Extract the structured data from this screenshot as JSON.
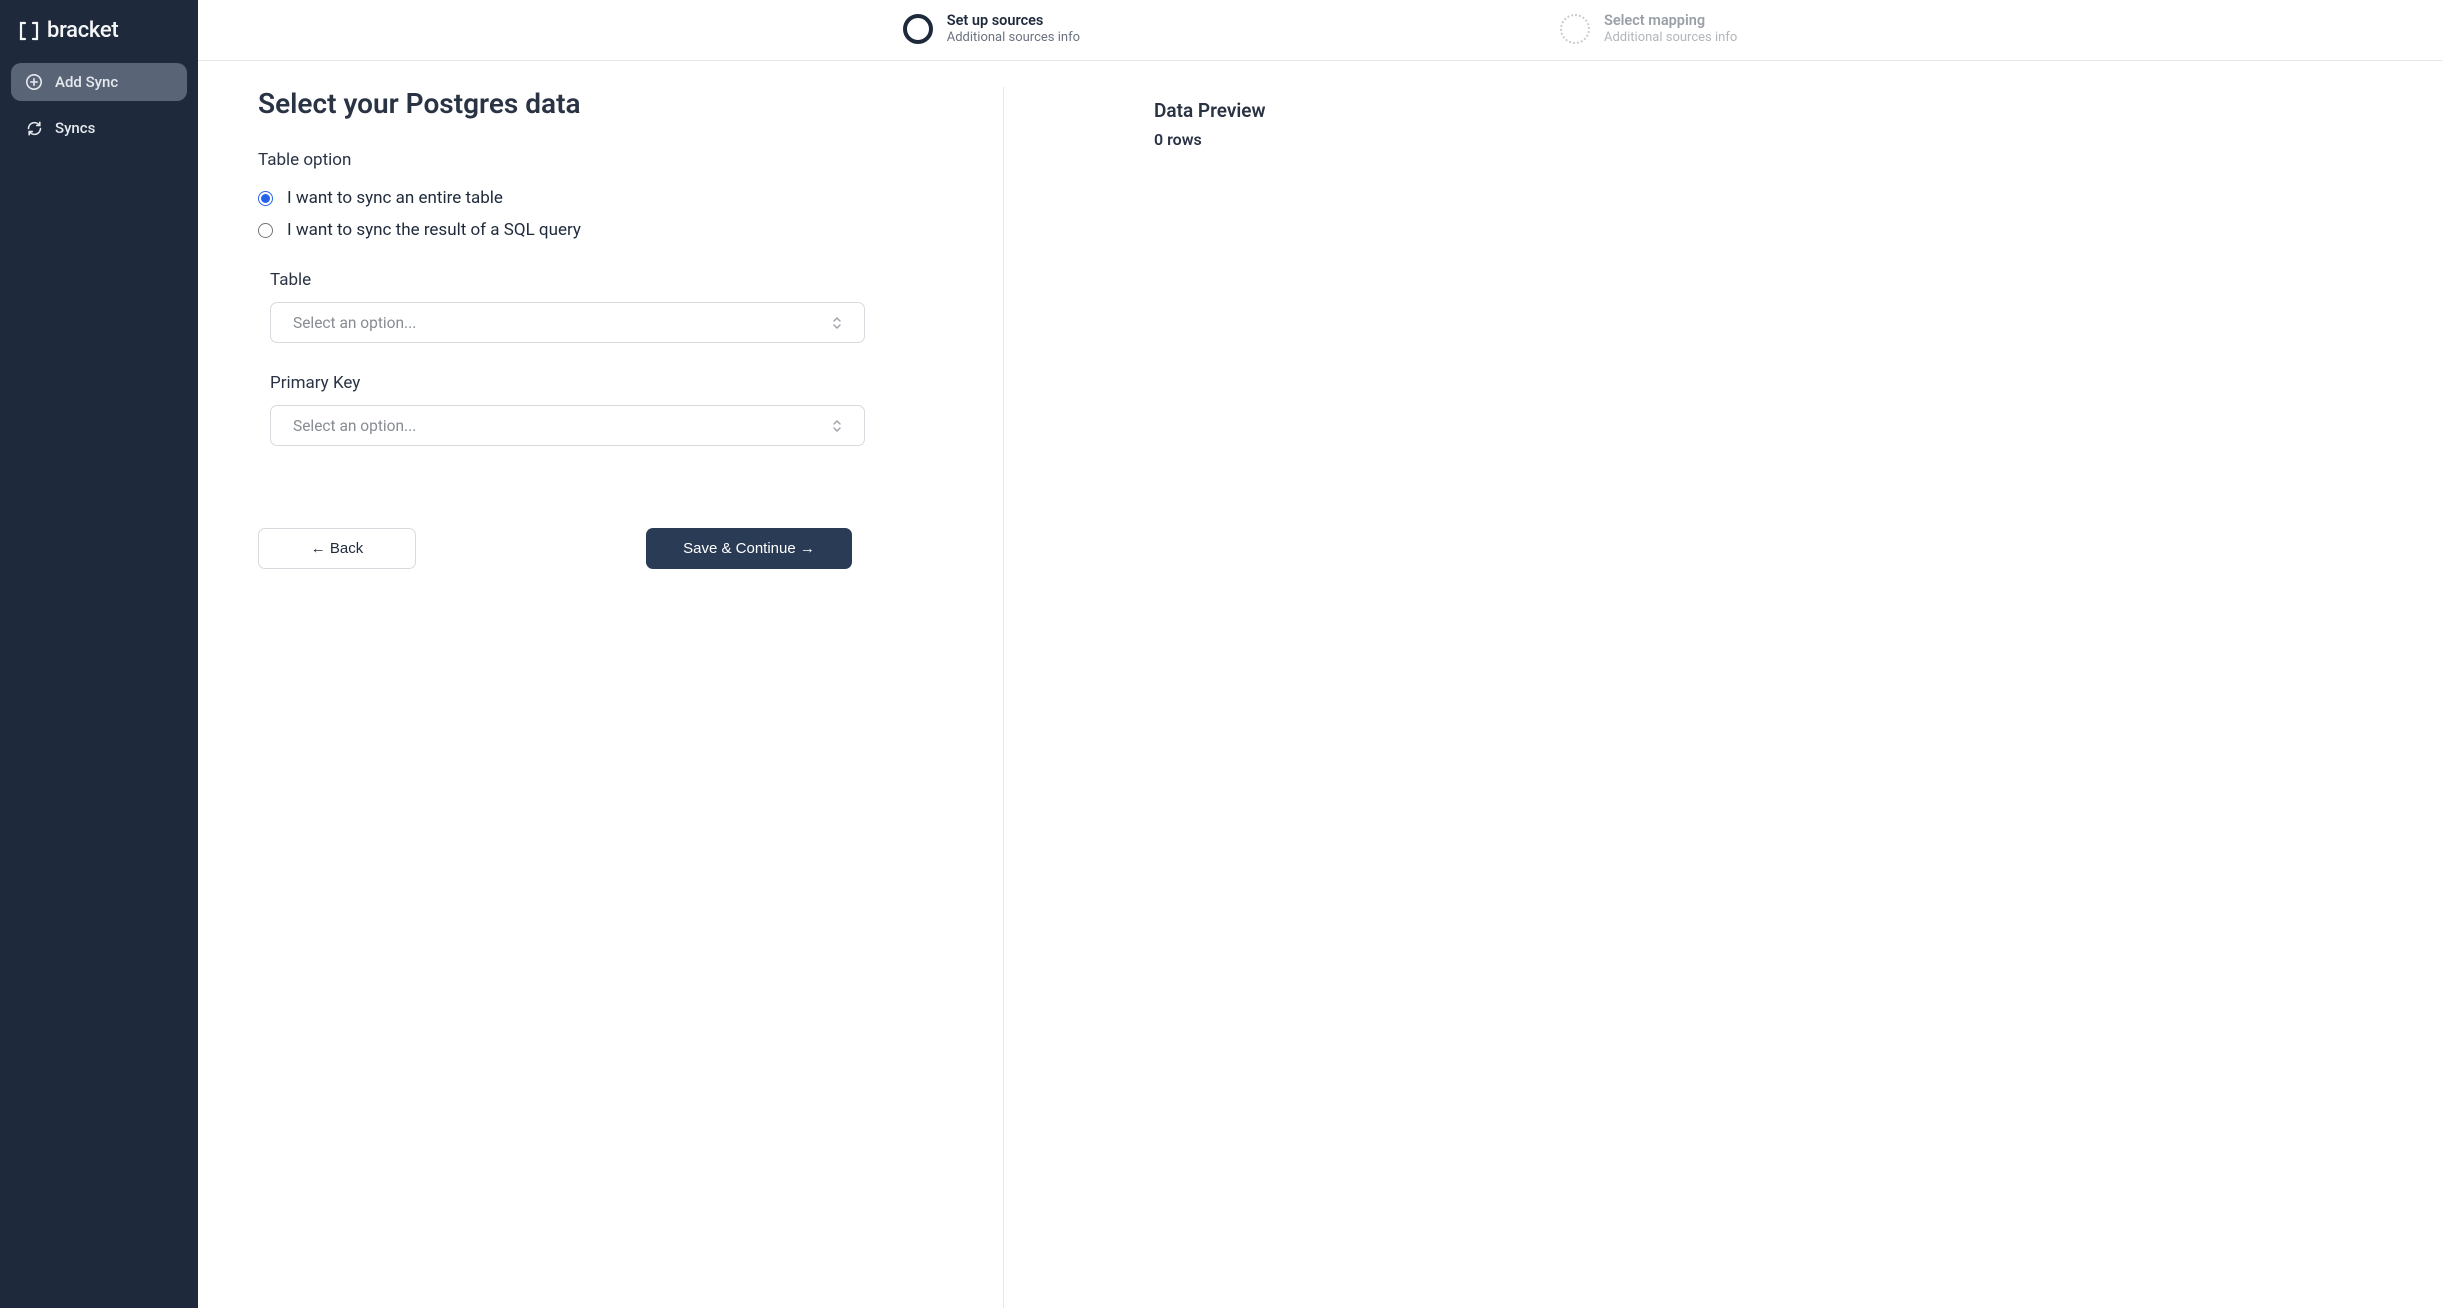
{
  "sidebar": {
    "brand": "bracket",
    "items": [
      {
        "label": "Add Sync"
      },
      {
        "label": "Syncs"
      }
    ]
  },
  "stepper": {
    "step1": {
      "title": "Set up sources",
      "sub": "Additional sources info"
    },
    "step2": {
      "title": "Select mapping",
      "sub": "Additional sources info"
    }
  },
  "main": {
    "title": "Select your Postgres data",
    "table_option_label": "Table option",
    "radio_entire_table": "I want to sync an entire table",
    "radio_sql_query": "I want to sync the result of a SQL query",
    "table_label": "Table",
    "table_placeholder": "Select an option...",
    "primary_key_label": "Primary Key",
    "primary_key_placeholder": "Select an option...",
    "back_button": "← Back",
    "continue_button": "Save & Continue →"
  },
  "preview": {
    "title": "Data Preview",
    "rows": "0 rows"
  }
}
